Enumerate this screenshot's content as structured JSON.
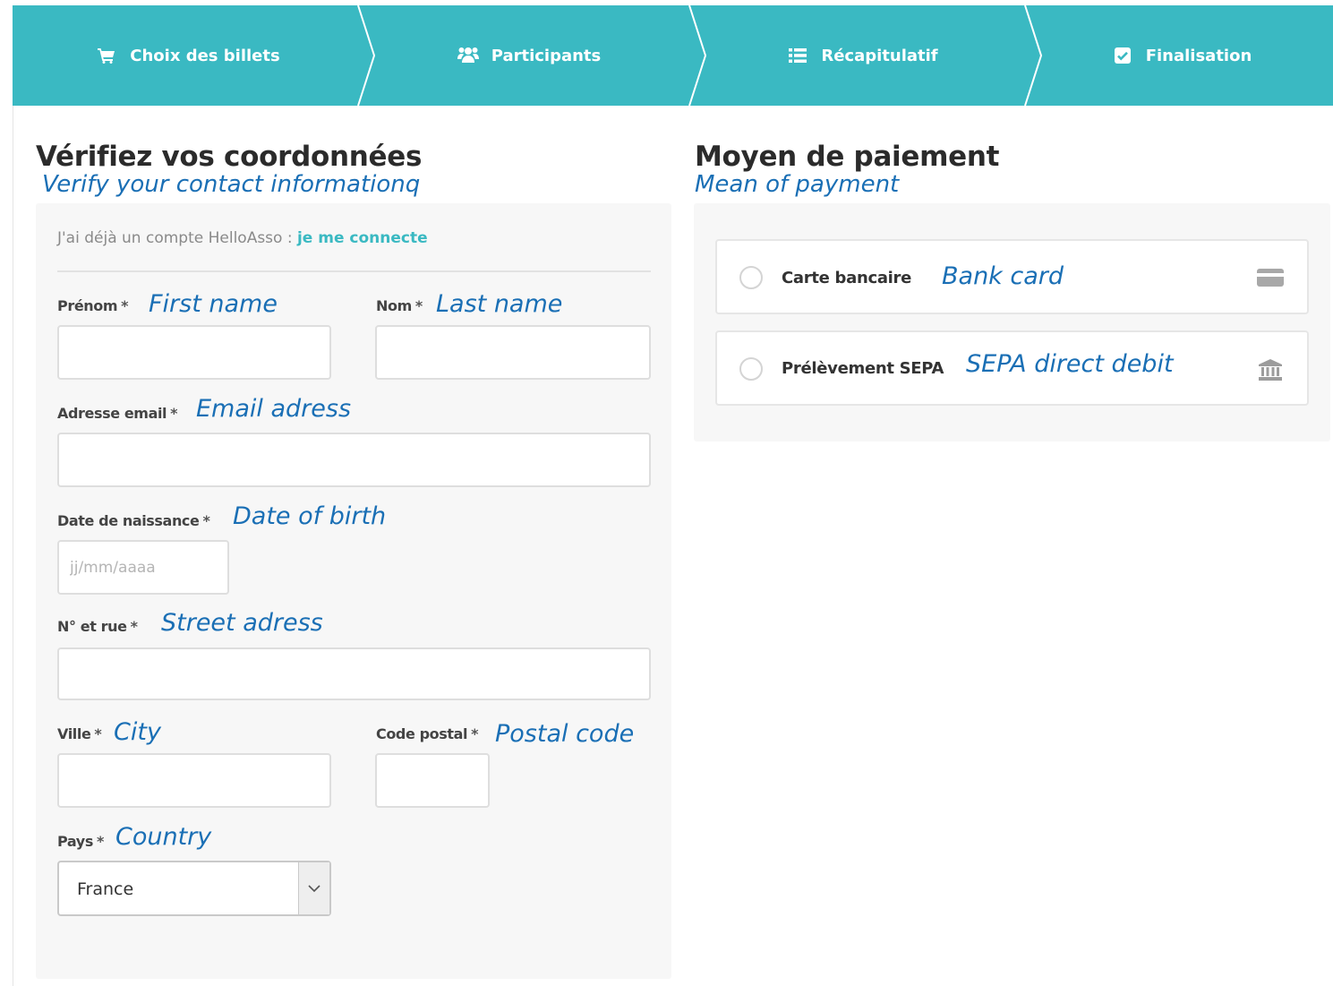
{
  "stepper": {
    "steps": [
      {
        "label": "Choix des billets",
        "icon": "cart-icon"
      },
      {
        "label": "Participants",
        "icon": "users-icon"
      },
      {
        "label": "Récapitulatif",
        "icon": "list-icon"
      },
      {
        "label": "Finalisation",
        "icon": "checkbox-icon"
      }
    ],
    "color": "#3ab9c2"
  },
  "contact": {
    "title": "Vérifiez vos coordonnées",
    "translation": "Verify your contact informationq",
    "account_text": "J'ai déjà un compte HelloAsso : ",
    "account_link": "je me connecte",
    "fields": {
      "first_name": {
        "label": "Prénom",
        "required": "*",
        "translation": "First name",
        "value": ""
      },
      "last_name": {
        "label": "Nom",
        "required": "*",
        "translation": "Last name",
        "value": ""
      },
      "email": {
        "label": "Adresse email",
        "required": "*",
        "translation": "Email adress",
        "value": ""
      },
      "birth_date": {
        "label": "Date de naissance",
        "required": "*",
        "translation": "Date of birth",
        "value": "",
        "placeholder": "jj/mm/aaaa"
      },
      "street": {
        "label": "N° et rue",
        "required": "*",
        "translation": "Street adress",
        "value": ""
      },
      "city": {
        "label": "Ville",
        "required": "*",
        "translation": "City",
        "value": ""
      },
      "postal_code": {
        "label": "Code postal",
        "required": "*",
        "translation": "Postal code",
        "value": ""
      },
      "country": {
        "label": "Pays",
        "required": "*",
        "translation": "Country",
        "selected": "France"
      }
    }
  },
  "payment": {
    "title": "Moyen de paiement",
    "translation": "Mean of payment",
    "options": [
      {
        "label": "Carte bancaire",
        "translation": "Bank card",
        "icon": "credit-card-icon"
      },
      {
        "label": "Prélèvement SEPA",
        "translation": "SEPA direct debit",
        "icon": "bank-icon"
      }
    ]
  },
  "colors": {
    "accent": "#3ab9c2",
    "translation_text": "#1a6fb5",
    "panel_bg": "#f7f7f7"
  }
}
